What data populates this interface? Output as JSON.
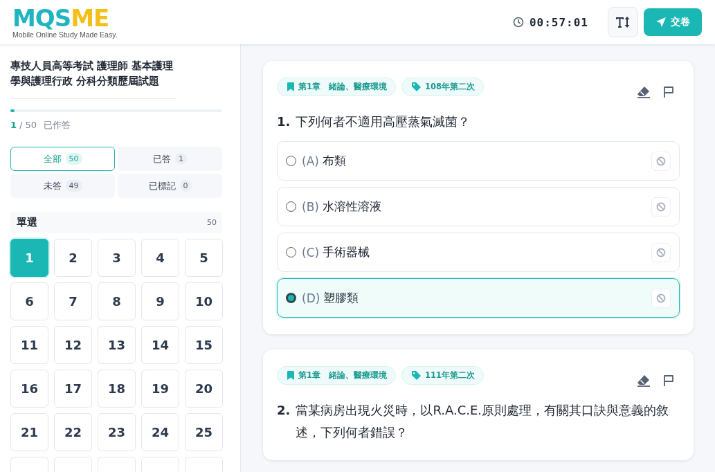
{
  "header": {
    "logo": {
      "parts": [
        {
          "text": "MQS",
          "color": "#1fb5c0"
        },
        {
          "text": "ME",
          "color": "#f5bf19"
        }
      ],
      "tagline": "Mobile Online Study Made Easy."
    },
    "timer": "00:57:01",
    "submit_label": "交卷"
  },
  "sidebar": {
    "title": "專技人員高等考試 護理師 基本護理學與護理行政 分科分類歷屆試題",
    "progress": {
      "level": 0.02,
      "answered": "1",
      "total": "/ 50",
      "label": "已作答"
    },
    "filters": [
      {
        "label": "全部",
        "count": "50",
        "selected": true
      },
      {
        "label": "已答",
        "count": "1",
        "selected": false
      },
      {
        "label": "未答",
        "count": "49",
        "selected": false
      },
      {
        "label": "已標記",
        "count": "0",
        "selected": false
      }
    ],
    "section": {
      "title": "單選",
      "count": "50"
    },
    "questions": [
      {
        "number": "1",
        "selected": true
      },
      {
        "number": "2",
        "selected": false
      },
      {
        "number": "3",
        "selected": false
      },
      {
        "number": "4",
        "selected": false
      },
      {
        "number": "5",
        "selected": false
      },
      {
        "number": "6",
        "selected": false
      },
      {
        "number": "7",
        "selected": false
      },
      {
        "number": "8",
        "selected": false
      },
      {
        "number": "9",
        "selected": false
      },
      {
        "number": "10",
        "selected": false
      },
      {
        "number": "11",
        "selected": false
      },
      {
        "number": "12",
        "selected": false
      },
      {
        "number": "13",
        "selected": false
      },
      {
        "number": "14",
        "selected": false
      },
      {
        "number": "15",
        "selected": false
      },
      {
        "number": "16",
        "selected": false
      },
      {
        "number": "17",
        "selected": false
      },
      {
        "number": "18",
        "selected": false
      },
      {
        "number": "19",
        "selected": false
      },
      {
        "number": "20",
        "selected": false
      },
      {
        "number": "21",
        "selected": false
      },
      {
        "number": "22",
        "selected": false
      },
      {
        "number": "23",
        "selected": false
      },
      {
        "number": "24",
        "selected": false
      },
      {
        "number": "25",
        "selected": false
      }
    ]
  },
  "cards": [
    {
      "chapter": "第1章　緒論、醫療環境",
      "exam": "108年第二次",
      "number": "1.",
      "text": "下列何者不適用高壓蒸氣滅菌？",
      "options": [
        {
          "letter": "(A)",
          "text": "布類",
          "selected": false
        },
        {
          "letter": "(B)",
          "text": "水溶性溶液",
          "selected": false
        },
        {
          "letter": "(C)",
          "text": "手術器械",
          "selected": false
        },
        {
          "letter": "(D)",
          "text": "塑膠類",
          "selected": true
        }
      ]
    },
    {
      "chapter": "第1章　緒論、醫療環境",
      "exam": "111年第二次",
      "number": "2.",
      "text": "當某病房出現火災時，以R.A.C.E.原則處理，有關其口訣與意義的敘述，下列何者錯誤？"
    }
  ]
}
